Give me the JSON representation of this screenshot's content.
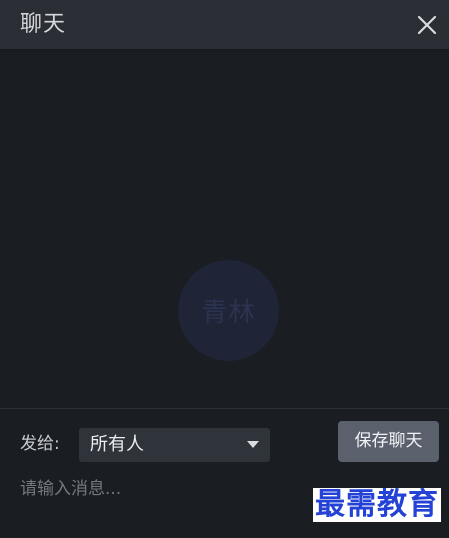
{
  "header": {
    "title": "聊天",
    "close_icon": "close-icon"
  },
  "messages": {
    "avatar_text": "青林"
  },
  "composer": {
    "send_to_label": "发给:",
    "recipient": "所有人",
    "save_label": "保存聊天",
    "input_placeholder": "请输入消息...",
    "input_value": ""
  },
  "watermark": {
    "text": "最需教育"
  },
  "colors": {
    "background": "#1a1d22",
    "titlebar": "#2b2e34",
    "select_bg": "#2f333a",
    "button_bg": "#5a616d",
    "watermark": "#2442d6"
  }
}
